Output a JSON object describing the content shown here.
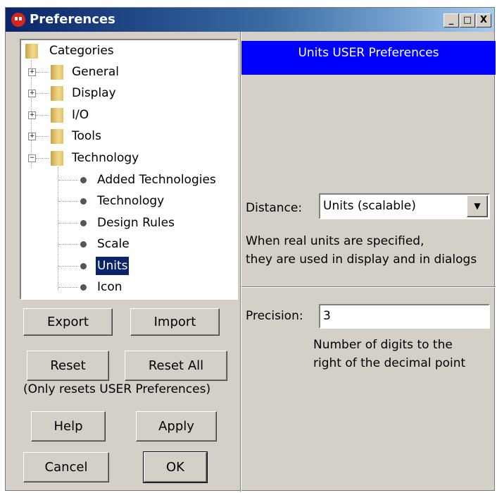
{
  "window": {
    "title": "Preferences",
    "min_label": "_",
    "max_label": "□",
    "close_label": "X"
  },
  "tree": {
    "root": "Categories",
    "folders": [
      {
        "label": "General",
        "expander": "+"
      },
      {
        "label": "Display",
        "expander": "+"
      },
      {
        "label": "I/O",
        "expander": "+"
      },
      {
        "label": "Tools",
        "expander": "+"
      },
      {
        "label": "Technology",
        "expander": "−"
      }
    ],
    "children": [
      "Added Technologies",
      "Technology",
      "Design Rules",
      "Scale",
      "Units",
      "Icon"
    ],
    "selected": "Units"
  },
  "buttons": {
    "export": "Export",
    "import": "Import",
    "reset": "Reset",
    "reset_all": "Reset All",
    "reset_note": "(Only resets USER Preferences)",
    "help": "Help",
    "apply": "Apply",
    "cancel": "Cancel",
    "ok": "OK"
  },
  "panel": {
    "header": "Units USER Preferences",
    "distance_label": "Distance:",
    "distance_value": "Units (scalable)",
    "distance_note_1": "When real units are specified,",
    "distance_note_2": "they are used in display and in dialogs",
    "precision_label": "Precision:",
    "precision_value": "3",
    "precision_note_1": "Number of digits to the",
    "precision_note_2": "right of the decimal point"
  },
  "colors": {
    "titlebar_start": "#0a246a",
    "header_bg": "#0000ff",
    "selection": "#0a246a",
    "face": "#d4d0c8"
  }
}
